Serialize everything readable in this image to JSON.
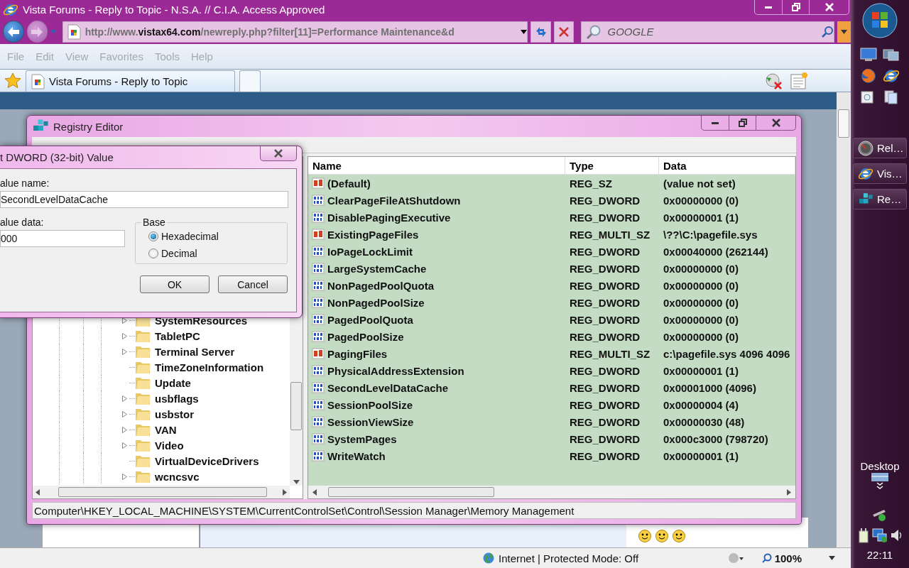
{
  "browser": {
    "title": "Vista Forums - Reply to Topic - N.S.A. // C.I.A. Access Approved",
    "url": "http://www.**vistax64.com**/newreply.php?filter[11]=Performance Maintenance&d",
    "search": {
      "placeholder": "GOOGLE"
    },
    "menu": [
      "File",
      "Edit",
      "View",
      "Favorites",
      "Tools",
      "Help"
    ],
    "tabs": [
      {
        "label": "Vista Forums - Reply to Topic",
        "selected": true
      }
    ],
    "status": {
      "zone": "Internet | Protected Mode: Off",
      "zoom": "100%"
    }
  },
  "registry_editor": {
    "title": "Registry Editor",
    "tree": [
      {
        "label": "SystemResources",
        "expandable": true
      },
      {
        "label": "TabletPC",
        "expandable": true
      },
      {
        "label": "Terminal Server",
        "expandable": true
      },
      {
        "label": "TimeZoneInformation",
        "expandable": false
      },
      {
        "label": "Update",
        "expandable": false
      },
      {
        "label": "usbflags",
        "expandable": true
      },
      {
        "label": "usbstor",
        "expandable": true
      },
      {
        "label": "VAN",
        "expandable": true
      },
      {
        "label": "Video",
        "expandable": true
      },
      {
        "label": "VirtualDeviceDrivers",
        "expandable": false
      },
      {
        "label": "wcncsvc",
        "expandable": true
      }
    ],
    "columns": [
      "Name",
      "Type",
      "Data"
    ],
    "rows": [
      {
        "kind": "string",
        "name": "(Default)",
        "type": "REG_SZ",
        "data": "(value not set)"
      },
      {
        "kind": "binary",
        "name": "ClearPageFileAtShutdown",
        "type": "REG_DWORD",
        "data": "0x00000000 (0)"
      },
      {
        "kind": "binary",
        "name": "DisablePagingExecutive",
        "type": "REG_DWORD",
        "data": "0x00000001 (1)"
      },
      {
        "kind": "string",
        "name": "ExistingPageFiles",
        "type": "REG_MULTI_SZ",
        "data": "\\??\\C:\\pagefile.sys"
      },
      {
        "kind": "binary",
        "name": "IoPageLockLimit",
        "type": "REG_DWORD",
        "data": "0x00040000 (262144)"
      },
      {
        "kind": "binary",
        "name": "LargeSystemCache",
        "type": "REG_DWORD",
        "data": "0x00000000 (0)"
      },
      {
        "kind": "binary",
        "name": "NonPagedPoolQuota",
        "type": "REG_DWORD",
        "data": "0x00000000 (0)"
      },
      {
        "kind": "binary",
        "name": "NonPagedPoolSize",
        "type": "REG_DWORD",
        "data": "0x00000000 (0)"
      },
      {
        "kind": "binary",
        "name": "PagedPoolQuota",
        "type": "REG_DWORD",
        "data": "0x00000000 (0)"
      },
      {
        "kind": "binary",
        "name": "PagedPoolSize",
        "type": "REG_DWORD",
        "data": "0x00000000 (0)"
      },
      {
        "kind": "string",
        "name": "PagingFiles",
        "type": "REG_MULTI_SZ",
        "data": "c:\\pagefile.sys 4096 4096"
      },
      {
        "kind": "binary",
        "name": "PhysicalAddressExtension",
        "type": "REG_DWORD",
        "data": "0x00000001 (1)"
      },
      {
        "kind": "binary",
        "name": "SecondLevelDataCache",
        "type": "REG_DWORD",
        "data": "0x00001000 (4096)"
      },
      {
        "kind": "binary",
        "name": "SessionPoolSize",
        "type": "REG_DWORD",
        "data": "0x00000004 (4)"
      },
      {
        "kind": "binary",
        "name": "SessionViewSize",
        "type": "REG_DWORD",
        "data": "0x00000030 (48)"
      },
      {
        "kind": "binary",
        "name": "SystemPages",
        "type": "REG_DWORD",
        "data": "0x000c3000 (798720)"
      },
      {
        "kind": "binary",
        "name": "WriteWatch",
        "type": "REG_DWORD",
        "data": "0x00000001 (1)"
      }
    ],
    "status_bar": "Computer\\HKEY_LOCAL_MACHINE\\SYSTEM\\CurrentControlSet\\Control\\Session Manager\\Memory Management"
  },
  "dialog": {
    "title": "t DWORD (32-bit) Value",
    "value_name_label": "alue name:",
    "value_name": "SecondLevelDataCache",
    "value_data_label": "alue data:",
    "value_data": "000",
    "base": {
      "label": "Base",
      "options": [
        {
          "label": "Hexadecimal",
          "selected": true
        },
        {
          "label": "Decimal",
          "selected": false
        }
      ]
    },
    "buttons": [
      "OK",
      "Cancel"
    ]
  },
  "taskbar": {
    "buttons": [
      {
        "kind": "gauge",
        "label": "Rel…"
      },
      {
        "kind": "browser",
        "label": "Vis…"
      },
      {
        "kind": "registry",
        "label": "Re…"
      }
    ],
    "desktop_label": "Desktop",
    "clock": "22:11"
  }
}
